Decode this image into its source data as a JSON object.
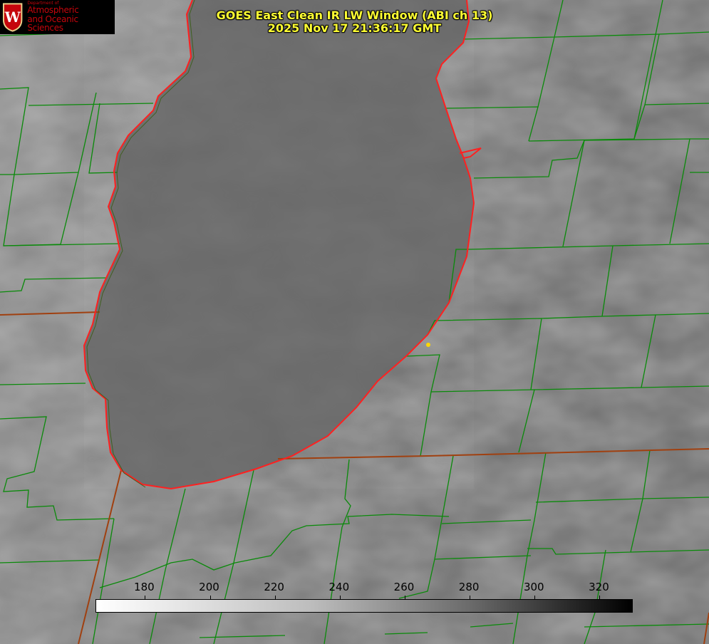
{
  "header": {
    "title_line1": "GOES East Clean IR LW Window (ABI ch 13)",
    "title_line2": "2025 Nov 17 21:36:17 GMT"
  },
  "logo": {
    "small": "Department of",
    "line1": "Atmospheric",
    "line2": "and Oceanic Sciences",
    "emblem": "W",
    "color": "#c5050c"
  },
  "colorbar": {
    "min": 165,
    "max": 330,
    "ticks": [
      "180",
      "200",
      "220",
      "240",
      "260",
      "280",
      "300",
      "320"
    ]
  },
  "colors": {
    "county_lines": "#0a8a0a",
    "coastline": "#ff2020",
    "state_lines": "#a04010",
    "title": "#ffff33",
    "marker": "#ffd700"
  }
}
